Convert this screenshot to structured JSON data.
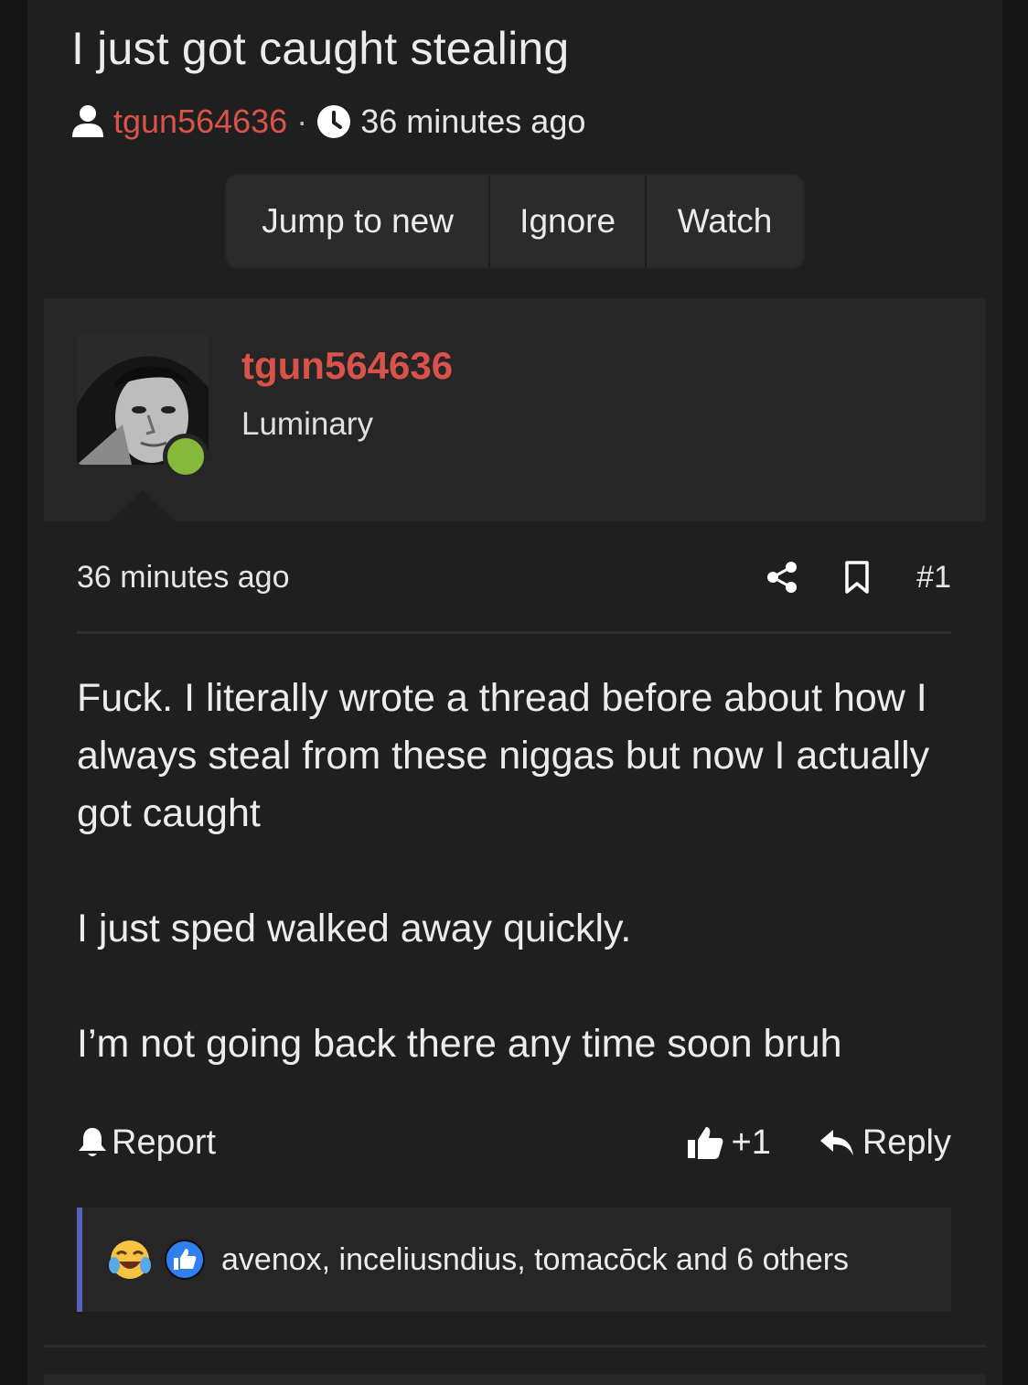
{
  "thread": {
    "title": "I just got caught stealing",
    "author": "tgun564636",
    "separator": "·",
    "time": "36 minutes ago"
  },
  "buttons": {
    "jump": "Jump to new",
    "ignore": "Ignore",
    "watch": "Watch"
  },
  "post": {
    "username": "tgun564636",
    "user_title": "Luminary",
    "time": "36 minutes ago",
    "number": "#1",
    "paragraphs": [
      "Fuck. I literally wrote a thread before about how I always steal from these niggas but now I actually got caught",
      "I just sped walked away quickly.",
      "I’m not going back there any time soon bruh"
    ],
    "actions": {
      "report": "Report",
      "like": "+1",
      "reply": "Reply"
    },
    "reactions": "avenox, inceliusndius, tomacōck and 6 others"
  },
  "colors": {
    "accent": "#d9534a",
    "online": "#86b83b",
    "reaction_bar": "#5b61b8"
  }
}
